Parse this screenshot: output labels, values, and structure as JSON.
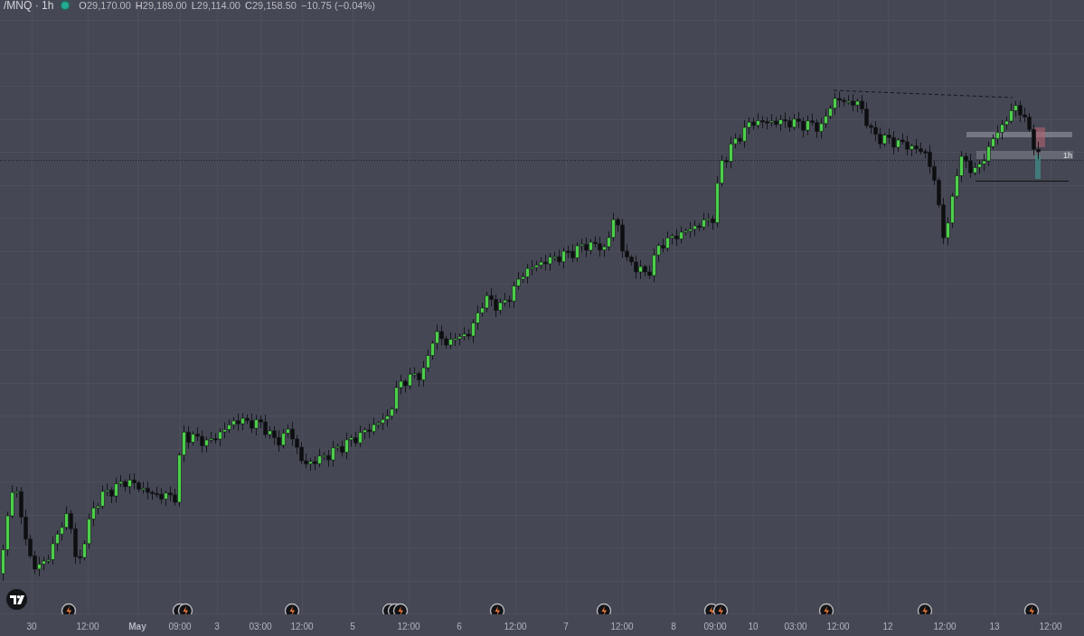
{
  "header": {
    "symbol": "/MNQ · 1h",
    "market_open": true,
    "open_label": "O",
    "open": "29,170.00",
    "high_label": "H",
    "high": "29,189.00",
    "low_label": "L",
    "low": "29,114.00",
    "close_label": "C",
    "close": "29,158.50",
    "change": "−10.75 (−0.04%)"
  },
  "chart": {
    "zone_label": "1h"
  },
  "time_axis": [
    {
      "label": "30",
      "kind": "day"
    },
    {
      "label": "12:00",
      "kind": "time"
    },
    {
      "label": "May",
      "kind": "month"
    },
    {
      "label": "09:00",
      "kind": "time"
    },
    {
      "label": "3",
      "kind": "day"
    },
    {
      "label": "03:00",
      "kind": "time"
    },
    {
      "label": "12:00",
      "kind": "time"
    },
    {
      "label": "5",
      "kind": "day"
    },
    {
      "label": "12:00",
      "kind": "time"
    },
    {
      "label": "6",
      "kind": "day"
    },
    {
      "label": "12:00",
      "kind": "time"
    },
    {
      "label": "7",
      "kind": "day"
    },
    {
      "label": "12:00",
      "kind": "time"
    },
    {
      "label": "8",
      "kind": "day"
    },
    {
      "label": "09:00",
      "kind": "time"
    },
    {
      "label": "10",
      "kind": "day"
    },
    {
      "label": "03:00",
      "kind": "time"
    },
    {
      "label": "12:00",
      "kind": "time"
    },
    {
      "label": "12",
      "kind": "day"
    },
    {
      "label": "12:00",
      "kind": "time"
    },
    {
      "label": "13",
      "kind": "day"
    },
    {
      "label": "12:00",
      "kind": "time"
    }
  ]
}
